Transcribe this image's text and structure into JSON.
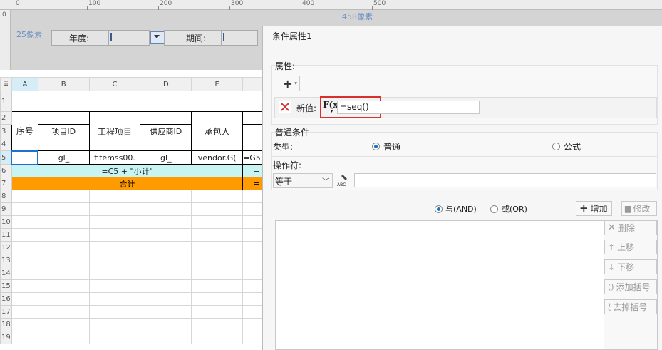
{
  "ruler": {
    "labels": [
      "0",
      "100",
      "200",
      "300",
      "400",
      "500"
    ],
    "vertical_label": "0",
    "width_note": "458像素"
  },
  "param_panel": {
    "height_note": "25像素",
    "year_label": "年度:",
    "period_label": "期间:"
  },
  "sheet": {
    "columns": [
      "A",
      "B",
      "C",
      "D",
      "E"
    ],
    "rows": [
      "1",
      "2",
      "3",
      "4",
      "5",
      "6",
      "7",
      "8",
      "9",
      "10",
      "11",
      "12",
      "13",
      "14",
      "15",
      "16",
      "17",
      "18",
      "19"
    ],
    "headers": {
      "seq": "序号",
      "project_id": "项目ID",
      "project_name": "工程项目",
      "supplier_id": "供应商ID",
      "contractor": "承包人"
    },
    "data_row": {
      "b": "gl_",
      "c": "fitemss00.",
      "d": "gl_",
      "e": "vendor.G(",
      "f": "=G5"
    },
    "subtotal": "=C5 + \"小计\"",
    "subtotal_f": "=",
    "total": "合计",
    "total_f": "="
  },
  "dialog": {
    "title": "条件属性1",
    "attributes_label": "属性:",
    "add_label": "+",
    "new_value_label": "新值:",
    "fx_label": "F(x)",
    "new_value": "=seq()",
    "general_condition_label": "普通条件",
    "type_label": "类型:",
    "type_normal": "普通",
    "type_formula": "公式",
    "operator_label": "操作符:",
    "operator_value": "等于",
    "and_label": "与(AND)",
    "or_label": "或(OR)",
    "add_button": "增加",
    "modify_button": "修改",
    "delete_button": "删除",
    "up_button": "上移",
    "down_button": "下移",
    "add_bracket_button": "添加括号",
    "remove_bracket_button": "去掉括号"
  },
  "colors": {
    "highlight_box": "#d9302e",
    "subtotal_bg": "#c8f4f4",
    "total_bg": "#ff9a00",
    "radio_on": "#1a73c7"
  }
}
